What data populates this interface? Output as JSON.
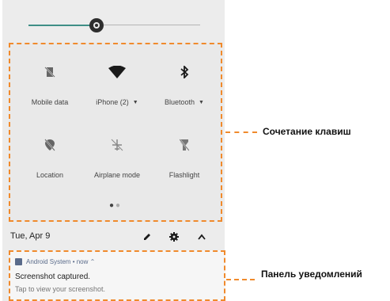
{
  "quick_settings": {
    "tiles": [
      {
        "label": "Mobile data",
        "icon": "mobile-data-off-icon",
        "has_dropdown": false
      },
      {
        "label": "iPhone (2)",
        "icon": "wifi-icon",
        "has_dropdown": true
      },
      {
        "label": "Bluetooth",
        "icon": "bluetooth-icon",
        "has_dropdown": true
      },
      {
        "label": "Location",
        "icon": "location-off-icon",
        "has_dropdown": false
      },
      {
        "label": "Airplane mode",
        "icon": "airplane-off-icon",
        "has_dropdown": false
      },
      {
        "label": "Flashlight",
        "icon": "flashlight-off-icon",
        "has_dropdown": false
      }
    ],
    "page_indicator": {
      "pages": 2,
      "current": 1
    }
  },
  "status_row": {
    "date": "Tue, Apr 9",
    "icons": [
      "edit-icon",
      "settings-gear-icon",
      "collapse-chevron-icon"
    ]
  },
  "notification": {
    "app": "Android System • now ⌃",
    "title": "Screenshot captured.",
    "text": "Tap to view your screenshot."
  },
  "annotations": {
    "quick_settings": "Сочетание клавиш",
    "notifications": "Панель уведомлений"
  },
  "colors": {
    "accent": "#f08a2c",
    "brightness_track": "#3f8f86"
  }
}
